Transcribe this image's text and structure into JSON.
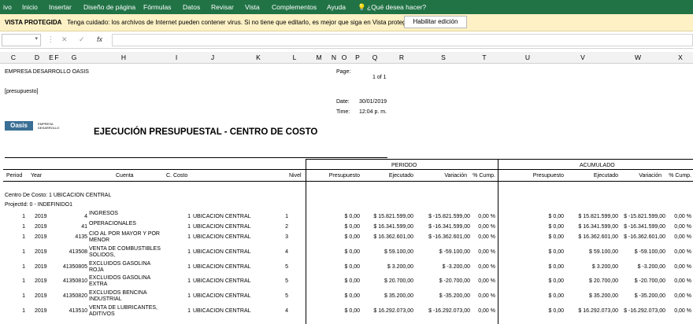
{
  "ribbon": {
    "tabs": [
      "ivo",
      "Inicio",
      "Insertar",
      "Diseño de página",
      "Fórmulas",
      "Datos",
      "Revisar",
      "Vista",
      "Complementos",
      "Ayuda",
      "¿Qué desea hacer?"
    ]
  },
  "protected_view": {
    "label": "VISTA PROTEGIDA",
    "message": "Tenga cuidado: los archivos de Internet pueden contener virus. Si no tiene que editarlo, es mejor que siga en Vista protegida.",
    "button": "Habilitar edición"
  },
  "formula_bar": {
    "cancel": "✕",
    "confirm": "✓",
    "fx": "fx"
  },
  "columns": [
    "C",
    "D",
    "E",
    "F",
    "G",
    "H",
    "I",
    "J",
    "K",
    "L",
    "M",
    "N",
    "O",
    "P",
    "Q",
    "R",
    "S",
    "T",
    "U",
    "V",
    "W",
    "X"
  ],
  "report": {
    "company": "EMPRESA DESARROLLO OASIS",
    "name": "[presupuesto]",
    "page_label": "Page:",
    "page_value": "1 of 1",
    "date_label": "Date:",
    "date_value": "30/01/2019",
    "time_label": "Time:",
    "time_value": "12:04 p. m.",
    "title": "EJECUCIÓN PRESUPUESTAL - CENTRO DE COSTO",
    "logo_text": "Oasis",
    "logo_sub": "EMPRESA DESARROLLO",
    "group_periodo": "PERIODO",
    "group_acumulado": "ACUMULADO",
    "headers": {
      "period": "Period",
      "year": "Year",
      "cuenta": "Cuenta",
      "costo": "C. Costo",
      "nivel": "Nivel",
      "presupuesto": "Presupuesto",
      "ejecutado": "Ejecutado",
      "variacion": "Variación",
      "cump": "% Cump.",
      "presupuesto2": "Presupuesto",
      "ejecutado2": "Ejecutado",
      "variacion2": "Variación",
      "cump2": "% Cump."
    },
    "centro": "Centro De Costo: 1 UBICACION CENTRAL",
    "project": "ProjectId: 0 - INDEFINIDO1",
    "rows": [
      {
        "period": "1",
        "year": "2019",
        "code": "4",
        "name": "INGRESOS",
        "cc": "1",
        "ccname": "UBICACION CENTRAL",
        "nivel": "1",
        "pres": "$ 0,00",
        "ejec": "$ 15.821.599,00",
        "var": "$ -15.821.599,00",
        "cump": "0,00 %",
        "pres2": "$ 0,00",
        "ejec2": "$ 15.821.599,00",
        "var2": "$ -15.821.599,00",
        "cump2": "0,00 %"
      },
      {
        "period": "1",
        "year": "2019",
        "code": "41",
        "name": "OPERACIONALES",
        "cc": "1",
        "ccname": "UBICACION CENTRAL",
        "nivel": "2",
        "pres": "$ 0,00",
        "ejec": "$ 16.341.599,00",
        "var": "$ -16.341.599,00",
        "cump": "0,00 %",
        "pres2": "$ 0,00",
        "ejec2": "$ 16.341.599,00",
        "var2": "$ -16.341.599,00",
        "cump2": "0,00 %"
      },
      {
        "period": "1",
        "year": "2019",
        "code": "4135",
        "name": "CIO AL POR MAYOR Y POR MENOR",
        "cc": "1",
        "ccname": "UBICACION CENTRAL",
        "nivel": "3",
        "pres": "$ 0,00",
        "ejec": "$ 16.362.601,00",
        "var": "$ -16.362.601,00",
        "cump": "0,00 %",
        "pres2": "$ 0,00",
        "ejec2": "$ 16.362.601,00",
        "var2": "$ -16.362.601,00",
        "cump2": "0,00 %"
      },
      {
        "period": "1",
        "year": "2019",
        "code": "413508",
        "name": "VENTA DE COMBUSTIBLES SOLIDOS,",
        "cc": "1",
        "ccname": "UBICACION CENTRAL",
        "nivel": "4",
        "pres": "$ 0,00",
        "ejec": "$ 59.100,00",
        "var": "$ -59.100,00",
        "cump": "0,00 %",
        "pres2": "$ 0,00",
        "ejec2": "$ 59.100,00",
        "var2": "$ -59.100,00",
        "cump2": "0,00 %"
      },
      {
        "period": "1",
        "year": "2019",
        "code": "41350805",
        "name": "EXCLUIDOS GASOLINA ROJA",
        "cc": "1",
        "ccname": "UBICACION CENTRAL",
        "nivel": "5",
        "pres": "$ 0,00",
        "ejec": "$ 3.200,00",
        "var": "$ -3.200,00",
        "cump": "0,00 %",
        "pres2": "$ 0,00",
        "ejec2": "$ 3.200,00",
        "var2": "$ -3.200,00",
        "cump2": "0,00 %"
      },
      {
        "period": "1",
        "year": "2019",
        "code": "41350810",
        "name": "EXCLUIDOS GASOLINA EXTRA",
        "cc": "1",
        "ccname": "UBICACION CENTRAL",
        "nivel": "5",
        "pres": "$ 0,00",
        "ejec": "$ 20.700,00",
        "var": "$ -20.700,00",
        "cump": "0,00 %",
        "pres2": "$ 0,00",
        "ejec2": "$ 20.700,00",
        "var2": "$ -20.700,00",
        "cump2": "0,00 %"
      },
      {
        "period": "1",
        "year": "2019",
        "code": "41350820",
        "name": "EXCLUIDOS BENCINA INDUSTRIAL",
        "cc": "1",
        "ccname": "UBICACION CENTRAL",
        "nivel": "5",
        "pres": "$ 0,00",
        "ejec": "$ 35.200,00",
        "var": "$ -35.200,00",
        "cump": "0,00 %",
        "pres2": "$ 0,00",
        "ejec2": "$ 35.200,00",
        "var2": "$ -35.200,00",
        "cump2": "0,00 %"
      },
      {
        "period": "1",
        "year": "2019",
        "code": "413510",
        "name": "VENTA DE LUBRICANTES, ADITIVOS",
        "cc": "1",
        "ccname": "UBICACION CENTRAL",
        "nivel": "4",
        "pres": "$ 0,00",
        "ejec": "$ 16.292.073,00",
        "var": "$ -16.292.073,00",
        "cump": "0,00 %",
        "pres2": "$ 0,00",
        "ejec2": "$ 16.292.073,00",
        "var2": "$ -16.292.073,00",
        "cump2": "0,00 %"
      }
    ]
  }
}
